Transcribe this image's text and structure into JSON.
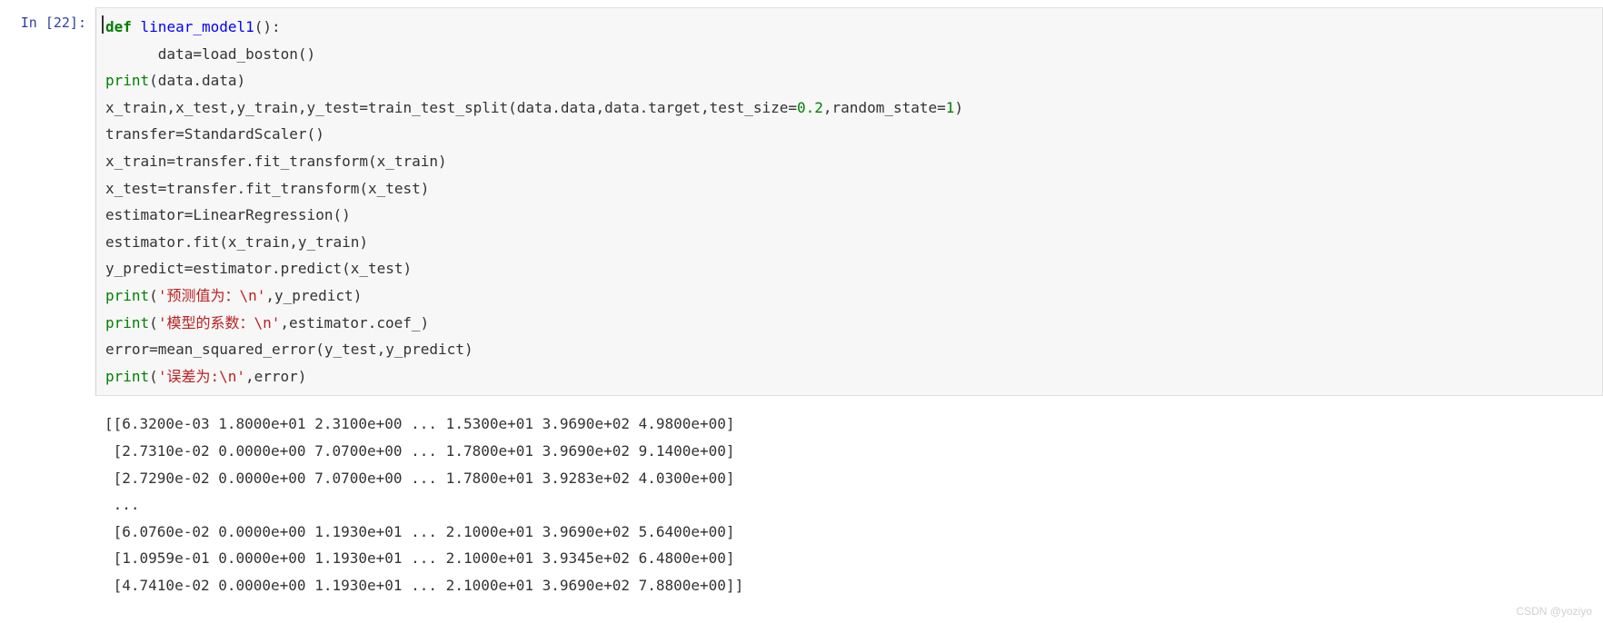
{
  "prompt": {
    "label": "In  [22]:"
  },
  "code": {
    "l1_def": "def",
    "l1_fn": " linear_model1",
    "l1_rest": "():",
    "l2": "      data=load_boston()",
    "l3_print": "print",
    "l3_rest": "(data.data)",
    "l4_a": "x_train,x_test,y_train,y_test=train_test_split(data.data,data.target,test_size=",
    "l4_num1": "0.2",
    "l4_b": ",random_state=",
    "l4_num2": "1",
    "l4_c": ")",
    "l5": "transfer=StandardScaler()",
    "l6": "x_train=transfer.fit_transform(x_train)",
    "l7": "x_test=transfer.fit_transform(x_test)",
    "l8": "estimator=LinearRegression()",
    "l9": "estimator.fit(x_train,y_train)",
    "l10": "y_predict=estimator.predict(x_test)",
    "l11_print": "print",
    "l11_str": "'预测值为：\\n'",
    "l11_rest": ",y_predict)",
    "l12_print": "print",
    "l12_str": "'模型的系数：\\n'",
    "l12_rest": ",estimator.coef_)",
    "l13": "error=mean_squared_error(y_test,y_predict)",
    "l14_print": "print",
    "l14_str": "'误差为:\\n'",
    "l14_rest": ",error)"
  },
  "output": {
    "line1": "[[6.3200e-03 1.8000e+01 2.3100e+00 ... 1.5300e+01 3.9690e+02 4.9800e+00]",
    "line2": " [2.7310e-02 0.0000e+00 7.0700e+00 ... 1.7800e+01 3.9690e+02 9.1400e+00]",
    "line3": " [2.7290e-02 0.0000e+00 7.0700e+00 ... 1.7800e+01 3.9283e+02 4.0300e+00]",
    "line4": " ...",
    "line5": " [6.0760e-02 0.0000e+00 1.1930e+01 ... 2.1000e+01 3.9690e+02 5.6400e+00]",
    "line6": " [1.0959e-01 0.0000e+00 1.1930e+01 ... 2.1000e+01 3.9345e+02 6.4800e+00]",
    "line7": " [4.7410e-02 0.0000e+00 1.1930e+01 ... 2.1000e+01 3.9690e+02 7.8800e+00]]"
  },
  "watermark": "CSDN @yoziyo"
}
